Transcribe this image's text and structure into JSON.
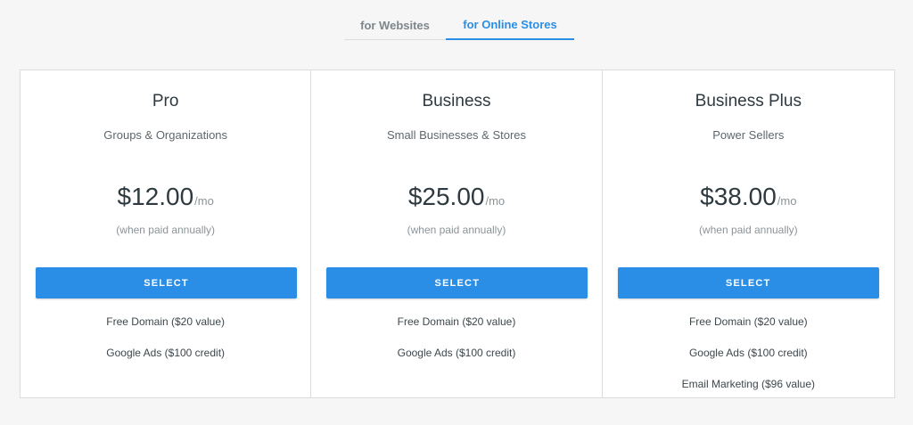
{
  "tabs": [
    {
      "label": "for Websites",
      "active": false
    },
    {
      "label": "for Online Stores",
      "active": true
    }
  ],
  "colors": {
    "accent": "#2b8ee6",
    "border": "#dcdcdc",
    "background": "#f6f6f6"
  },
  "plans": [
    {
      "name": "Pro",
      "subtitle": "Groups & Organizations",
      "price": "$12.00",
      "period": "/mo",
      "billing_note": "(when paid annually)",
      "button_label": "SELECT",
      "features": [
        "Free Domain ($20 value)",
        "Google Ads ($100 credit)"
      ]
    },
    {
      "name": "Business",
      "subtitle": "Small Businesses & Stores",
      "price": "$25.00",
      "period": "/mo",
      "billing_note": "(when paid annually)",
      "button_label": "SELECT",
      "features": [
        "Free Domain ($20 value)",
        "Google Ads ($100 credit)"
      ]
    },
    {
      "name": "Business Plus",
      "subtitle": "Power Sellers",
      "price": "$38.00",
      "period": "/mo",
      "billing_note": "(when paid annually)",
      "button_label": "SELECT",
      "features": [
        "Free Domain ($20 value)",
        "Google Ads ($100 credit)",
        "Email Marketing ($96 value)"
      ]
    }
  ]
}
